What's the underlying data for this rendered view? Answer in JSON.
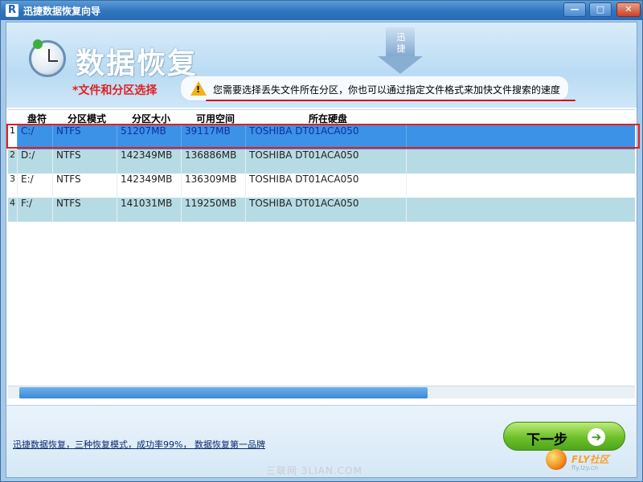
{
  "window": {
    "app_icon": "R",
    "title": "迅捷数据恢复向导",
    "minimize": "—",
    "maximize": "□",
    "close": "✕"
  },
  "header": {
    "title": "数据恢复",
    "section": "*文件和分区选择",
    "brand_text": "迅\n捷",
    "tip_icon": "warning-icon",
    "tip_text": "您需要选择丢失文件所在分区，你也可以通过指定文件格式来加快文件搜索的速度"
  },
  "table": {
    "columns": [
      "盘符",
      "分区模式",
      "分区大小",
      "可用空间",
      "所在硬盘"
    ],
    "rows": [
      {
        "index": "1",
        "drive": "C:/",
        "mode": "NTFS",
        "size": "51207MB",
        "free": "39117MB",
        "disk": "TOSHIBA DT01ACA050",
        "selected": true
      },
      {
        "index": "2",
        "drive": "D:/",
        "mode": "NTFS",
        "size": "142349MB",
        "free": "136886MB",
        "disk": "TOSHIBA DT01ACA050",
        "selected": false
      },
      {
        "index": "3",
        "drive": "E:/",
        "mode": "NTFS",
        "size": "142349MB",
        "free": "136309MB",
        "disk": "TOSHIBA DT01ACA050",
        "selected": false
      },
      {
        "index": "4",
        "drive": "F:/",
        "mode": "NTFS",
        "size": "141031MB",
        "free": "119250MB",
        "disk": "TOSHIBA DT01ACA050",
        "selected": false
      }
    ]
  },
  "footer": {
    "link_text": "迅捷数据恢复，三种恢复模式，成功率99%， 数据恢复第一品牌",
    "next_label": "下一步",
    "next_icon": "arrow-right-icon",
    "watermark": "三联网 3LIAN.COM",
    "logo_text": "FLY社区",
    "logo_sub": "fly.lzy.cn"
  },
  "colors": {
    "selected_row": "#3b92e6",
    "alt_row": "#b7dbe4",
    "highlight_red": "#e02020",
    "next_green": "#6cc02a"
  }
}
